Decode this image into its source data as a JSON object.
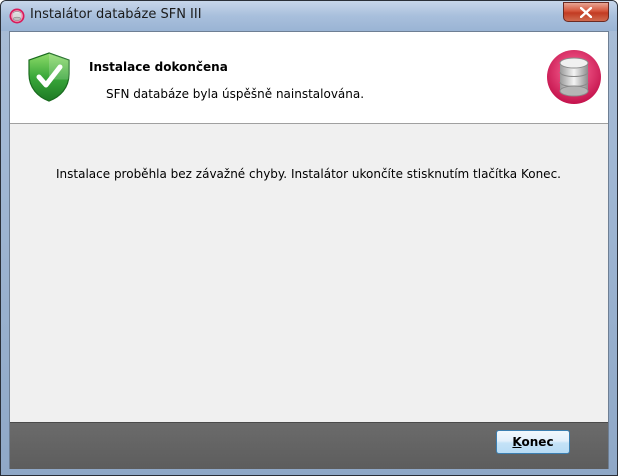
{
  "window": {
    "title": "Instalátor databáze SFN III",
    "close_glyph": "X"
  },
  "header": {
    "title": "Instalace dokončena",
    "subtitle": "SFN databáze byla úspěšně nainstalována.",
    "left_icon": "shield-check-icon",
    "right_icon": "database-icon"
  },
  "content": {
    "message": "Instalace proběhla bez závažné chyby. Instalátor ukončíte stisknutím tlačítka Konec."
  },
  "footer": {
    "finish_button": {
      "accel": "K",
      "rest": "onec"
    }
  },
  "colors": {
    "titlebar": "#a8bfdc",
    "close_button": "#c23b22",
    "content_bg": "#f0f0f0",
    "footer_bg": "#5d5d5d",
    "accent_shield": "#3aa83a",
    "accent_db_ring": "#d81b5a"
  }
}
